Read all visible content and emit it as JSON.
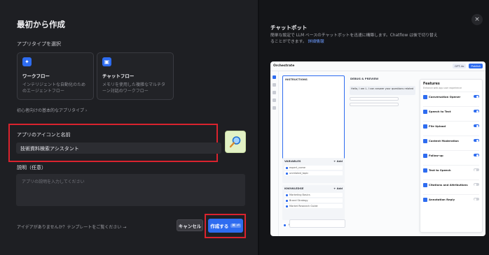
{
  "dialog": {
    "title": "最初から作成",
    "app_type_label": "アプリタイプを選択",
    "app_types": [
      {
        "title": "ワークフロー",
        "desc": "インテリジェントな自動化のためのエージェントフロー",
        "icon": "workflow-icon",
        "color": "#2e6cf0"
      },
      {
        "title": "チャットフロー",
        "desc": "メモリを使用した複雑なマルチターン対話のワークフロー",
        "icon": "chat-icon",
        "color": "#2e6cf0"
      }
    ],
    "basic_types_link": "初心者向けの基本的なアプリタイプ ›",
    "name_label": "アプリのアイコンと名前",
    "name_value": "技術資料検索アシスタント",
    "desc_label": "説明（任意）",
    "desc_placeholder": "アプリの説明を入力してください",
    "idea_link": "アイデアがありませんか？テンプレートをご覧ください →",
    "cancel_label": "キャンセル",
    "create_label": "作成する",
    "create_kbd": "⌘ ⏎",
    "avatar_emoji": "🔍"
  },
  "preview": {
    "title": "チャットボット",
    "desc": "簡単な設定で LLM ベースのチャットボットを迅速に構築します。Chatflow は後で切り替えることができます。",
    "link": "詳細情報",
    "close_glyph": "×",
    "top": {
      "name": "Orchestrate",
      "model": "GPT-4o",
      "publish": "Publish"
    },
    "instructions_label": "INSTRUCTIONS",
    "variables_label": "VARIABLES",
    "variables": [
      "expert_name",
      "unrelated_topic"
    ],
    "knowledge_label": "KNOWLEDGE",
    "knowledge": [
      "Marketing Basics",
      "Brand Strategy",
      "Market Research Guide"
    ],
    "vision_label": "Vision",
    "debug_label": "DEBUG & PREVIEW",
    "chat_greeting": "Hello, I am L. I can answer your questions related",
    "features_title": "Features",
    "features_sub": "Enhance web app user experience",
    "features": [
      {
        "name": "Conversation Opener",
        "on": true
      },
      {
        "name": "Speech to Text",
        "on": true
      },
      {
        "name": "File Upload",
        "on": true
      },
      {
        "name": "Content Moderation",
        "on": true
      },
      {
        "name": "Follow-up",
        "on": true
      },
      {
        "name": "Text to Speech",
        "on": false
      },
      {
        "name": "Citations and Attributions",
        "on": false
      },
      {
        "name": "Annotation Reply",
        "on": false
      }
    ]
  }
}
